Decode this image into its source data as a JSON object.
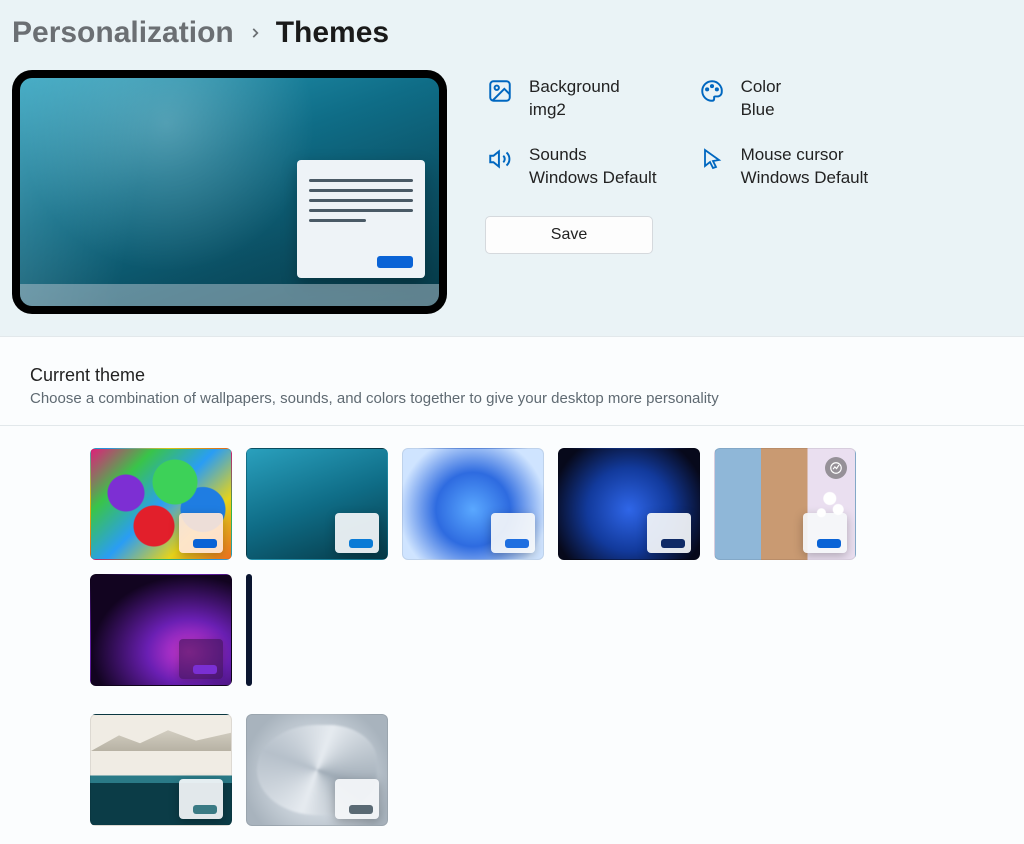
{
  "breadcrumb": {
    "parent": "Personalization",
    "current": "Themes"
  },
  "properties": {
    "background": {
      "label": "Background",
      "value": "img2"
    },
    "color": {
      "label": "Color",
      "value": "Blue"
    },
    "sounds": {
      "label": "Sounds",
      "value": "Windows Default"
    },
    "cursor": {
      "label": "Mouse cursor",
      "value": "Windows Default"
    }
  },
  "save_label": "Save",
  "section": {
    "title": "Current theme",
    "subtitle": "Choose a combination of wallpapers, sounds, and colors together to give your desktop more personality"
  },
  "themes": [
    {
      "name": "Colorful umbrellas",
      "accent": "#0a63d6",
      "badge_tint": "pink",
      "spotlight": false
    },
    {
      "name": "Underwater (img2)",
      "accent": "#0a7bd6",
      "spotlight": false
    },
    {
      "name": "Windows light bloom",
      "accent": "#1f6fe0",
      "spotlight": false
    },
    {
      "name": "Windows dark bloom",
      "accent": "#0f2a66",
      "spotlight": false
    },
    {
      "name": "Windows spotlight collage",
      "accent": "#0a63d6",
      "spotlight": true
    },
    {
      "name": "Glow (purple)",
      "accent": "#7a2fd3",
      "spotlight": false
    },
    {
      "name": "Captured motion (partial)",
      "accent": "#0a63d6",
      "spotlight": false
    },
    {
      "name": "Sunrise lake",
      "accent": "#3a7a84",
      "spotlight": false
    },
    {
      "name": "Flow (grey)",
      "accent": "#5a6a74",
      "spotlight": false
    }
  ]
}
